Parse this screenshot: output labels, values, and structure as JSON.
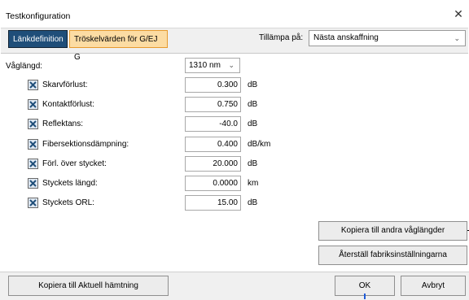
{
  "window": {
    "title": "Testkonfiguration",
    "close_glyph": "✕"
  },
  "tabs": [
    {
      "label": "Länkdefinition",
      "active": true
    },
    {
      "label": "Tröskelvärden för G/EJ G",
      "active": false
    }
  ],
  "apply": {
    "label": "Tillämpa på:",
    "value": "Nästa anskaffning"
  },
  "wavelength": {
    "label": "Våglängd:",
    "value": "1310 nm"
  },
  "thresholds": [
    {
      "label": "Skarvförlust:",
      "value": "0.300",
      "unit": "dB",
      "checked": true
    },
    {
      "label": "Kontaktförlust:",
      "value": "0.750",
      "unit": "dB",
      "checked": true
    },
    {
      "label": "Reflektans:",
      "value": "-40.0",
      "unit": "dB",
      "checked": true
    },
    {
      "label": "Fibersektionsdämpning:",
      "value": "0.400",
      "unit": "dB/km",
      "checked": true
    },
    {
      "label": "Förl. över stycket:",
      "value": "20.000",
      "unit": "dB",
      "checked": true
    },
    {
      "label": "Styckets längd:",
      "value": "0.0000",
      "unit": "km",
      "checked": true
    },
    {
      "label": "Styckets ORL:",
      "value": "15.00",
      "unit": "dB",
      "checked": true
    }
  ],
  "buttons": {
    "copy_wavelengths": "Kopiera till andra våglängder",
    "reset_factory": "Återställ fabriksinställningarna",
    "copy_acquisition": "Kopiera till Aktuell hämtning",
    "ok": "OK",
    "cancel": "Avbryt"
  },
  "colors": {
    "active_tab": "#1f4e79",
    "inactive_tab": "#fcdca3",
    "checkbox_mark": "#1f4e79"
  }
}
